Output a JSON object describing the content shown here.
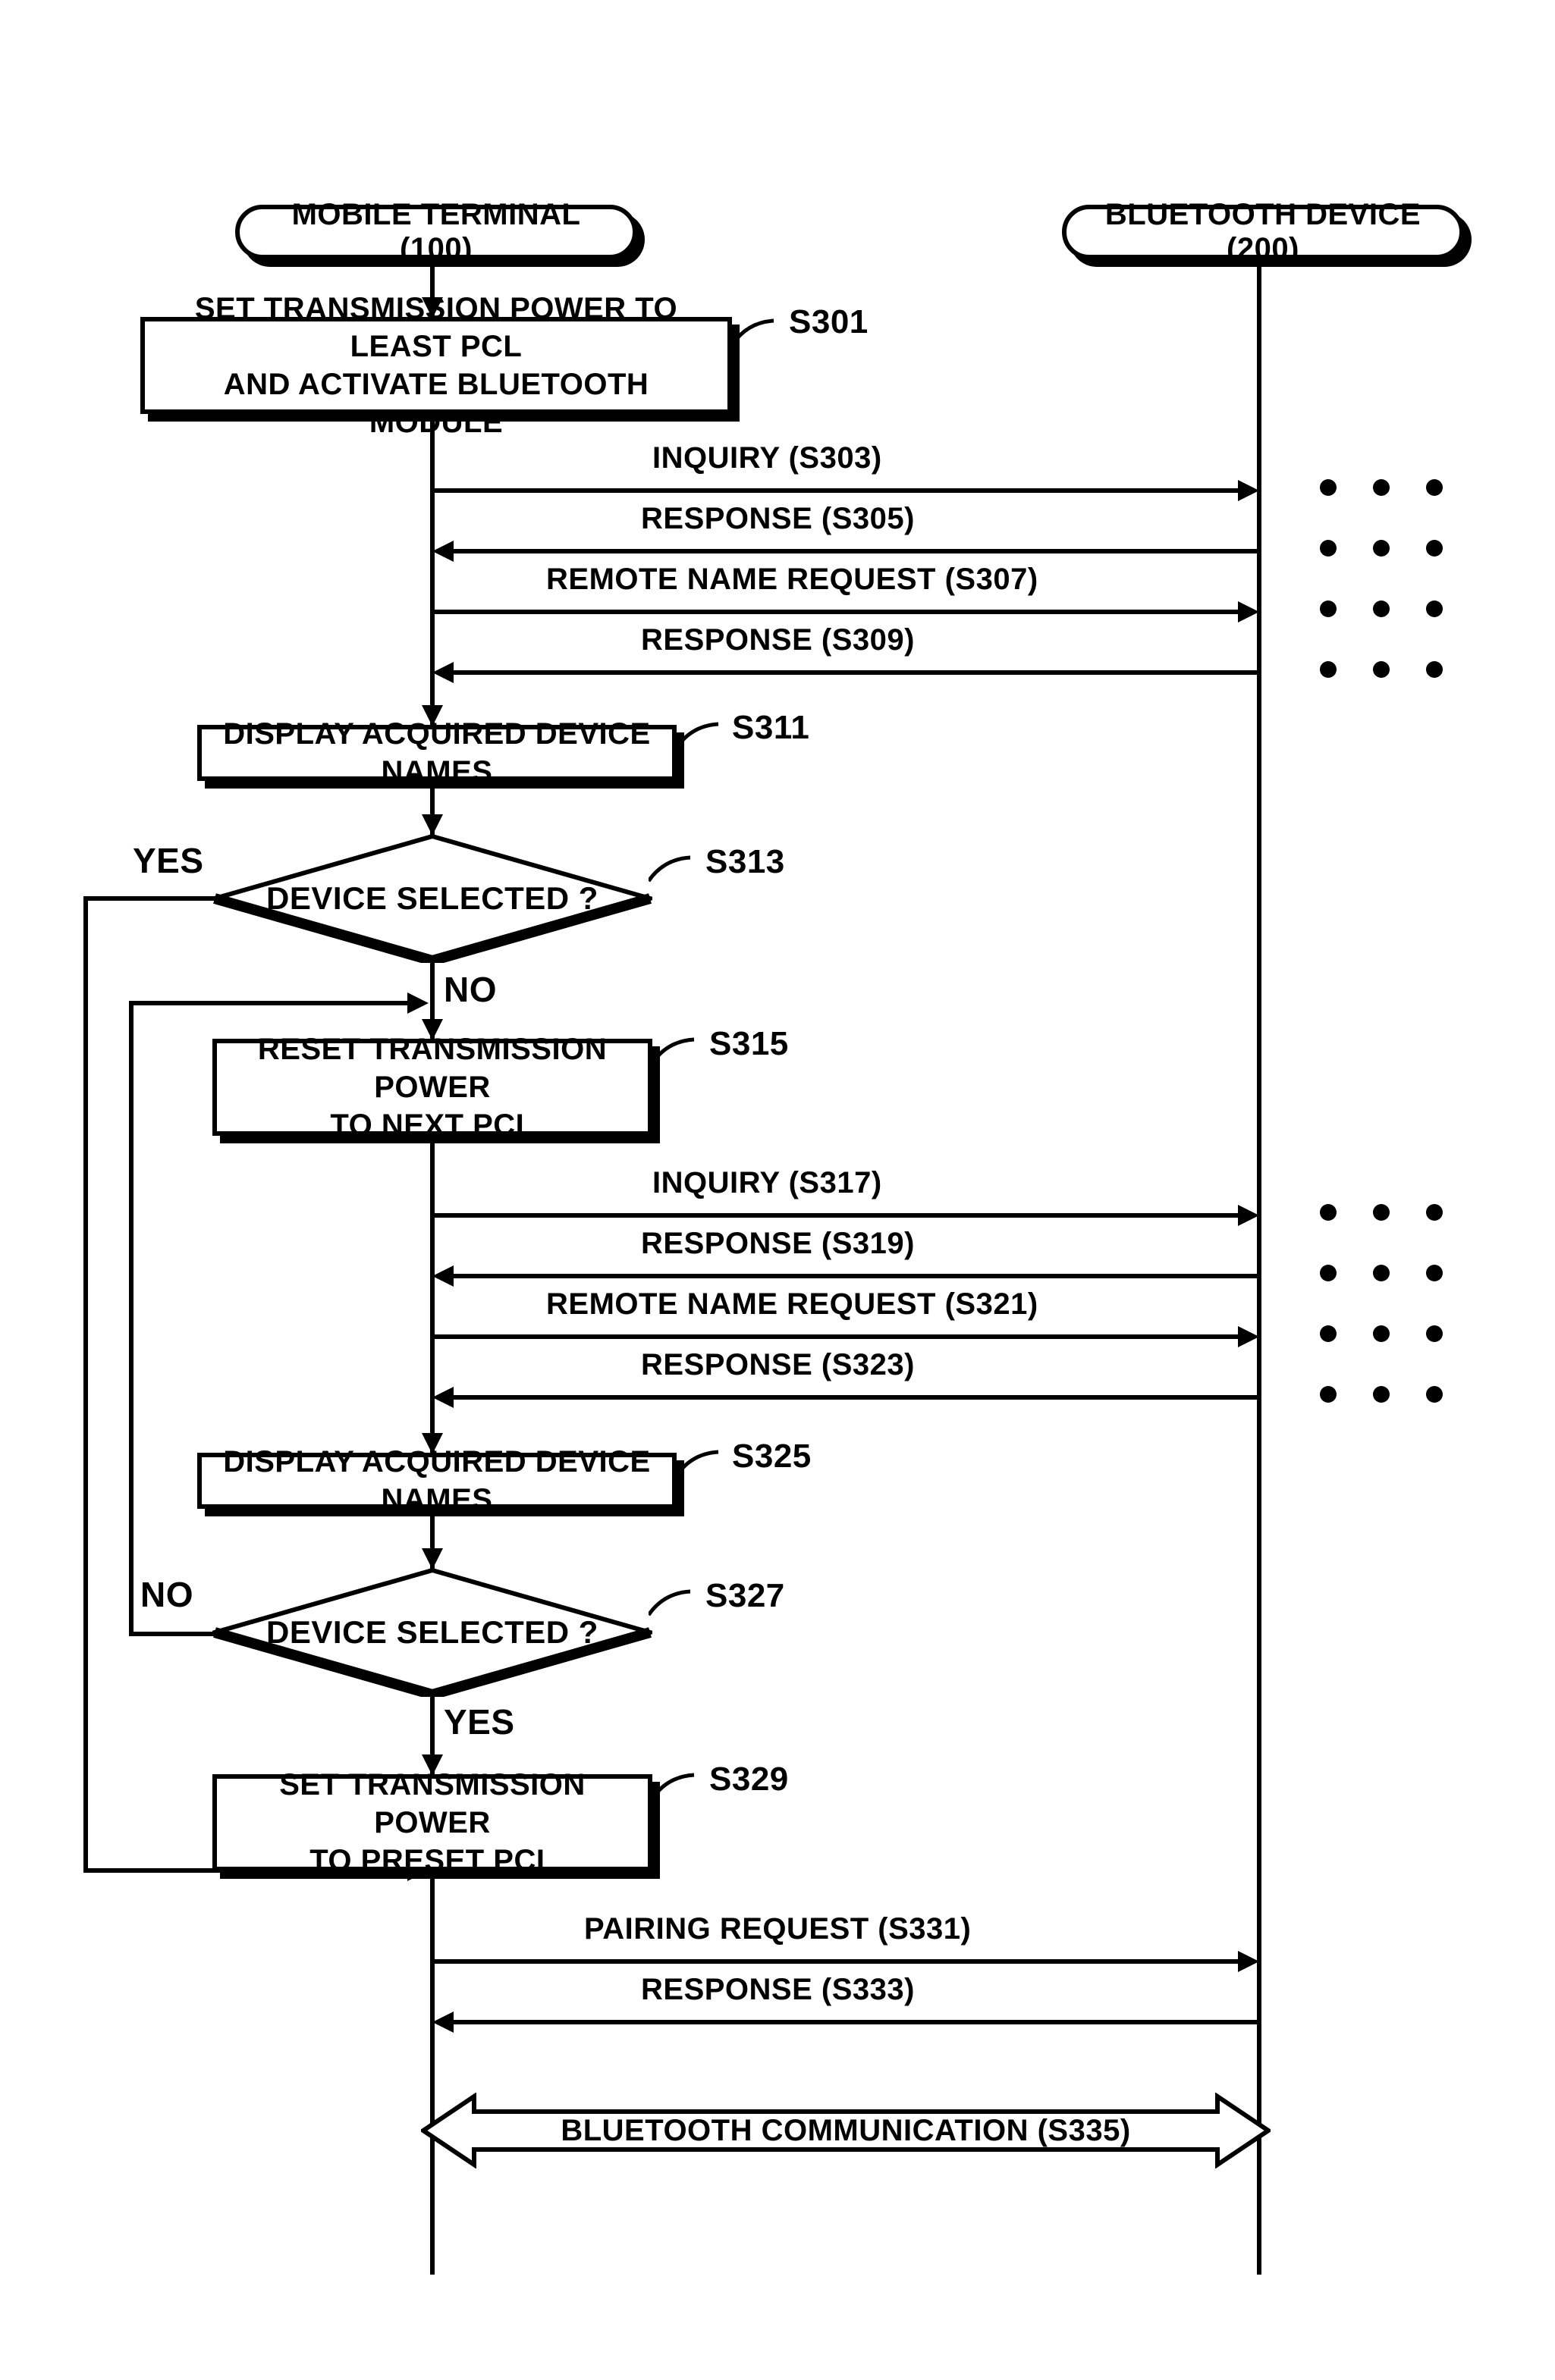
{
  "participants": {
    "mobile": "MOBILE TERMINAL (100)",
    "bluetooth": "BLUETOOTH DEVICE (200)"
  },
  "steps": {
    "s301": {
      "id": "S301",
      "text": "SET TRANSMISSION POWER TO LEAST PCL\nAND ACTIVATE BLUETOOTH MODULE"
    },
    "s303": {
      "id": "S303",
      "text": "INQUIRY (S303)"
    },
    "s305": {
      "id": "S305",
      "text": "RESPONSE (S305)"
    },
    "s307": {
      "id": "S307",
      "text": "REMOTE NAME REQUEST (S307)"
    },
    "s309": {
      "id": "S309",
      "text": "RESPONSE (S309)"
    },
    "s311": {
      "id": "S311",
      "text": "DISPLAY ACQUIRED DEVICE NAMES"
    },
    "s313": {
      "id": "S313",
      "text": "DEVICE SELECTED ?"
    },
    "s315": {
      "id": "S315",
      "text": "RESET TRANSMISSION POWER\nTO NEXT PCL"
    },
    "s317": {
      "id": "S317",
      "text": "INQUIRY (S317)"
    },
    "s319": {
      "id": "S319",
      "text": "RESPONSE (S319)"
    },
    "s321": {
      "id": "S321",
      "text": "REMOTE NAME REQUEST (S321)"
    },
    "s323": {
      "id": "S323",
      "text": "RESPONSE (S323)"
    },
    "s325": {
      "id": "S325",
      "text": "DISPLAY ACQUIRED DEVICE NAMES"
    },
    "s327": {
      "id": "S327",
      "text": "DEVICE SELECTED ?"
    },
    "s329": {
      "id": "S329",
      "text": "SET TRANSMISSION POWER\nTO PRESET PCL"
    },
    "s331": {
      "id": "S331",
      "text": "PAIRING REQUEST (S331)"
    },
    "s333": {
      "id": "S333",
      "text": "RESPONSE (S333)"
    },
    "s335": {
      "id": "S335",
      "text": "BLUETOOTH COMMUNICATION (S335)"
    }
  },
  "branches": {
    "s313_yes": "YES",
    "s313_no": "NO",
    "s327_no": "NO",
    "s327_yes": "YES"
  },
  "layout": {
    "lifelines": {
      "mobileX": 570,
      "btX": 1660,
      "topY": 340,
      "bottomY": 3000
    }
  }
}
